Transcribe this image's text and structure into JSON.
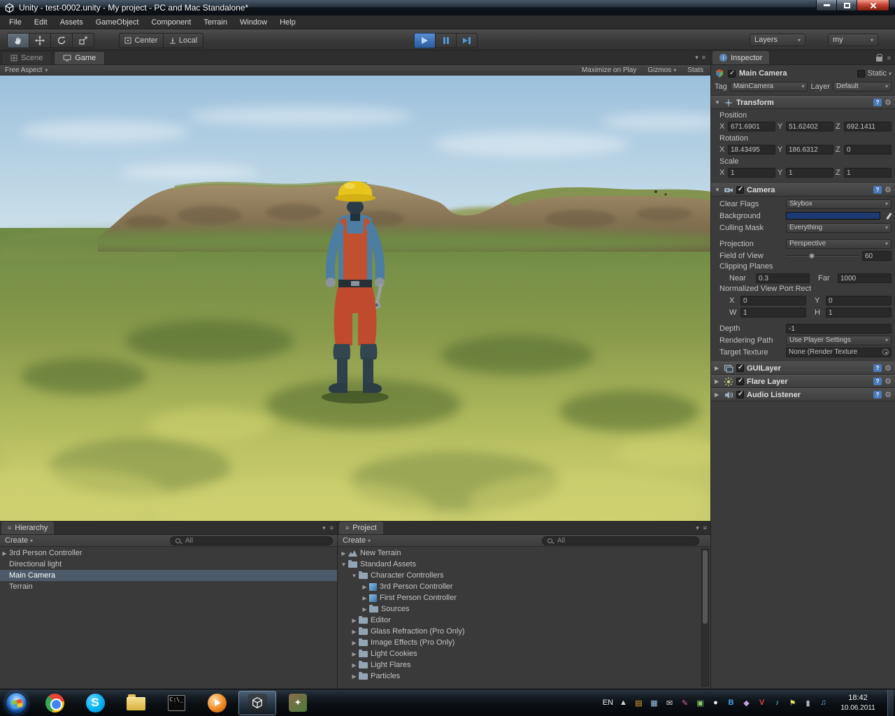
{
  "window": {
    "title": "Unity - test-0002.unity - My project - PC and Mac Standalone*"
  },
  "glyphs": {
    "dropdown": "▾",
    "expand": "▶",
    "collapse": "▼",
    "menu": "≡",
    "gear": "⚙",
    "help": "?",
    "info": "i"
  },
  "menu": {
    "items": [
      "File",
      "Edit",
      "Assets",
      "GameObject",
      "Component",
      "Terrain",
      "Window",
      "Help"
    ]
  },
  "toolbar": {
    "pivot": "Center",
    "space": "Local",
    "layers": "Layers",
    "layout": "my"
  },
  "tabs": {
    "scene": "Scene",
    "game": "Game"
  },
  "game_bar": {
    "aspect": "Free Aspect",
    "maximize_on_play": "Maximize on Play",
    "gizmos": "Gizmos",
    "stats": "Stats"
  },
  "hierarchy": {
    "tab": "Hierarchy",
    "create": "Create",
    "search": "All",
    "items": [
      {
        "label": "3rd Person Controller",
        "arrow": "▶"
      },
      {
        "label": "Directional light",
        "arrow": ""
      },
      {
        "label": "Main Camera",
        "arrow": ""
      },
      {
        "label": "Terrain",
        "arrow": ""
      }
    ]
  },
  "project": {
    "tab": "Project",
    "create": "Create",
    "search": "All",
    "items": [
      {
        "label": "New Terrain",
        "arrow": "▶",
        "icon": "terrain-icon"
      },
      {
        "label": "Standard Assets",
        "arrow": "▼",
        "icon": "folder-icon"
      },
      {
        "label": "Character Controllers",
        "arrow": "▼",
        "icon": "folder-icon"
      },
      {
        "label": "3rd Person Controller",
        "arrow": "▶",
        "icon": "prefab-icon"
      },
      {
        "label": "First Person Controller",
        "arrow": "▶",
        "icon": "prefab-icon"
      },
      {
        "label": "Sources",
        "arrow": "▶",
        "icon": "folder-icon"
      },
      {
        "label": "Editor",
        "arrow": "▶",
        "icon": "folder-icon"
      },
      {
        "label": "Glass Refraction (Pro Only)",
        "arrow": "▶",
        "icon": "folder-icon"
      },
      {
        "label": "Image Effects (Pro Only)",
        "arrow": "▶",
        "icon": "folder-icon"
      },
      {
        "label": "Light Cookies",
        "arrow": "▶",
        "icon": "folder-icon"
      },
      {
        "label": "Light Flares",
        "arrow": "▶",
        "icon": "folder-icon"
      },
      {
        "label": "Particles",
        "arrow": "▶",
        "icon": "folder-icon"
      }
    ]
  },
  "inspector": {
    "tab": "Inspector",
    "name": "Main Camera",
    "static_label": "Static",
    "tag_label": "Tag",
    "tag_value": "MainCamera",
    "layer_label": "Layer",
    "layer_value": "Default",
    "transform": {
      "title": "Transform",
      "position_label": "Position",
      "rotation_label": "Rotation",
      "scale_label": "Scale",
      "axis_x": "X",
      "axis_y": "Y",
      "axis_z": "Z",
      "position": {
        "x": "671.6901",
        "y": "51.62402",
        "z": "692.1411"
      },
      "rotation": {
        "x": "18.43495",
        "y": "186.6312",
        "z": "0"
      },
      "scale": {
        "x": "1",
        "y": "1",
        "z": "1"
      }
    },
    "camera": {
      "title": "Camera",
      "clear_flags_label": "Clear Flags",
      "clear_flags": "Skybox",
      "background_label": "Background",
      "culling_mask_label": "Culling Mask",
      "culling_mask": "Everything",
      "projection_label": "Projection",
      "projection": "Perspective",
      "fov_label": "Field of View",
      "fov": "60",
      "clipping_label": "Clipping Planes",
      "near_label": "Near",
      "near": "0.3",
      "far_label": "Far",
      "far": "1000",
      "viewport_label": "Normalized View Port Rect",
      "vx_label": "X",
      "vx": "0",
      "vy_label": "Y",
      "vy": "0",
      "vw_label": "W",
      "vw": "1",
      "vh_label": "H",
      "vh": "1",
      "depth_label": "Depth",
      "depth": "-1",
      "rendering_path_label": "Rendering Path",
      "rendering_path": "Use Player Settings",
      "target_texture_label": "Target Texture",
      "target_texture": "None (Render Texture"
    },
    "components": [
      {
        "title": "GUILayer"
      },
      {
        "title": "Flare Layer"
      },
      {
        "title": "Audio Listener"
      }
    ],
    "colors": {
      "camera_background": "#1d3a73"
    }
  },
  "taskbar": {
    "lang": "EN",
    "time": "18:42",
    "date": "10.06.2011",
    "cmd_text": "C:\\_",
    "skype_letter": "S",
    "app_glyph": "✦",
    "tray": [
      "▲",
      "▤",
      "▦",
      "✉",
      "✎",
      "▣",
      "●",
      "B",
      "◆",
      "V",
      "♪",
      "⚑",
      "▮",
      "♫"
    ]
  }
}
